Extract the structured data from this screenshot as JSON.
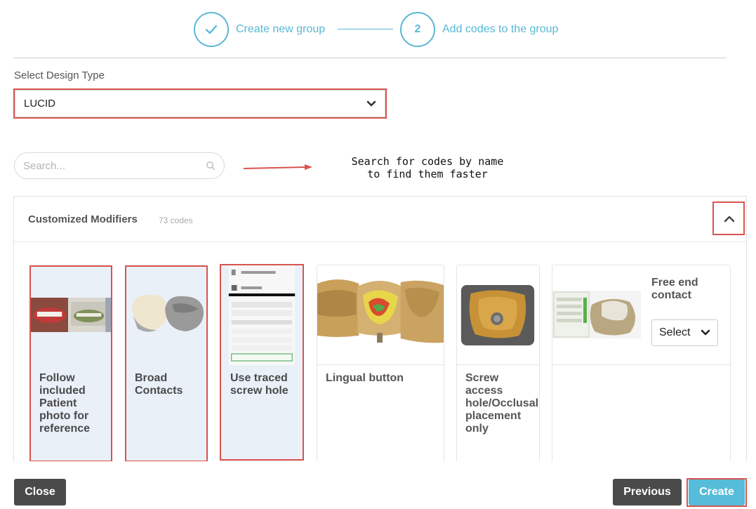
{
  "stepper": {
    "step1": {
      "label": "Create new group",
      "state": "done"
    },
    "step2": {
      "number": "2",
      "label": "Add codes to the group",
      "state": "active"
    }
  },
  "design_type": {
    "label": "Select Design Type",
    "value": "LUCID"
  },
  "search": {
    "placeholder": "Search...",
    "value": ""
  },
  "annotation": {
    "line1": "Search for codes by name",
    "line2": "to find them faster"
  },
  "group": {
    "title": "Customized Modifiers",
    "count": "73 codes",
    "expanded": true
  },
  "cards": [
    {
      "title": "Follow included Patient photo for reference",
      "selected": true,
      "image": "patient-photo"
    },
    {
      "title": "Broad Contacts",
      "selected": true,
      "image": "crown-pair"
    },
    {
      "title": "Use traced screw hole",
      "selected": true,
      "image": "software-panel"
    },
    {
      "title": "Lingual button",
      "selected": false,
      "image": "heatmap-crowns"
    },
    {
      "title": "Screw access hole/Occlusal placement only",
      "selected": false,
      "image": "crown-top-screw"
    },
    {
      "title": "Free end contact",
      "selected": false,
      "image": "contact-panel",
      "select_label": "Select"
    }
  ],
  "footer": {
    "close_label": "Close",
    "previous_label": "Previous",
    "create_label": "Create"
  },
  "colors": {
    "accent": "#5ab8d4",
    "highlight": "#d9534f",
    "selected_card": "#e9f0f8",
    "dark_button": "#4a4a4a"
  }
}
